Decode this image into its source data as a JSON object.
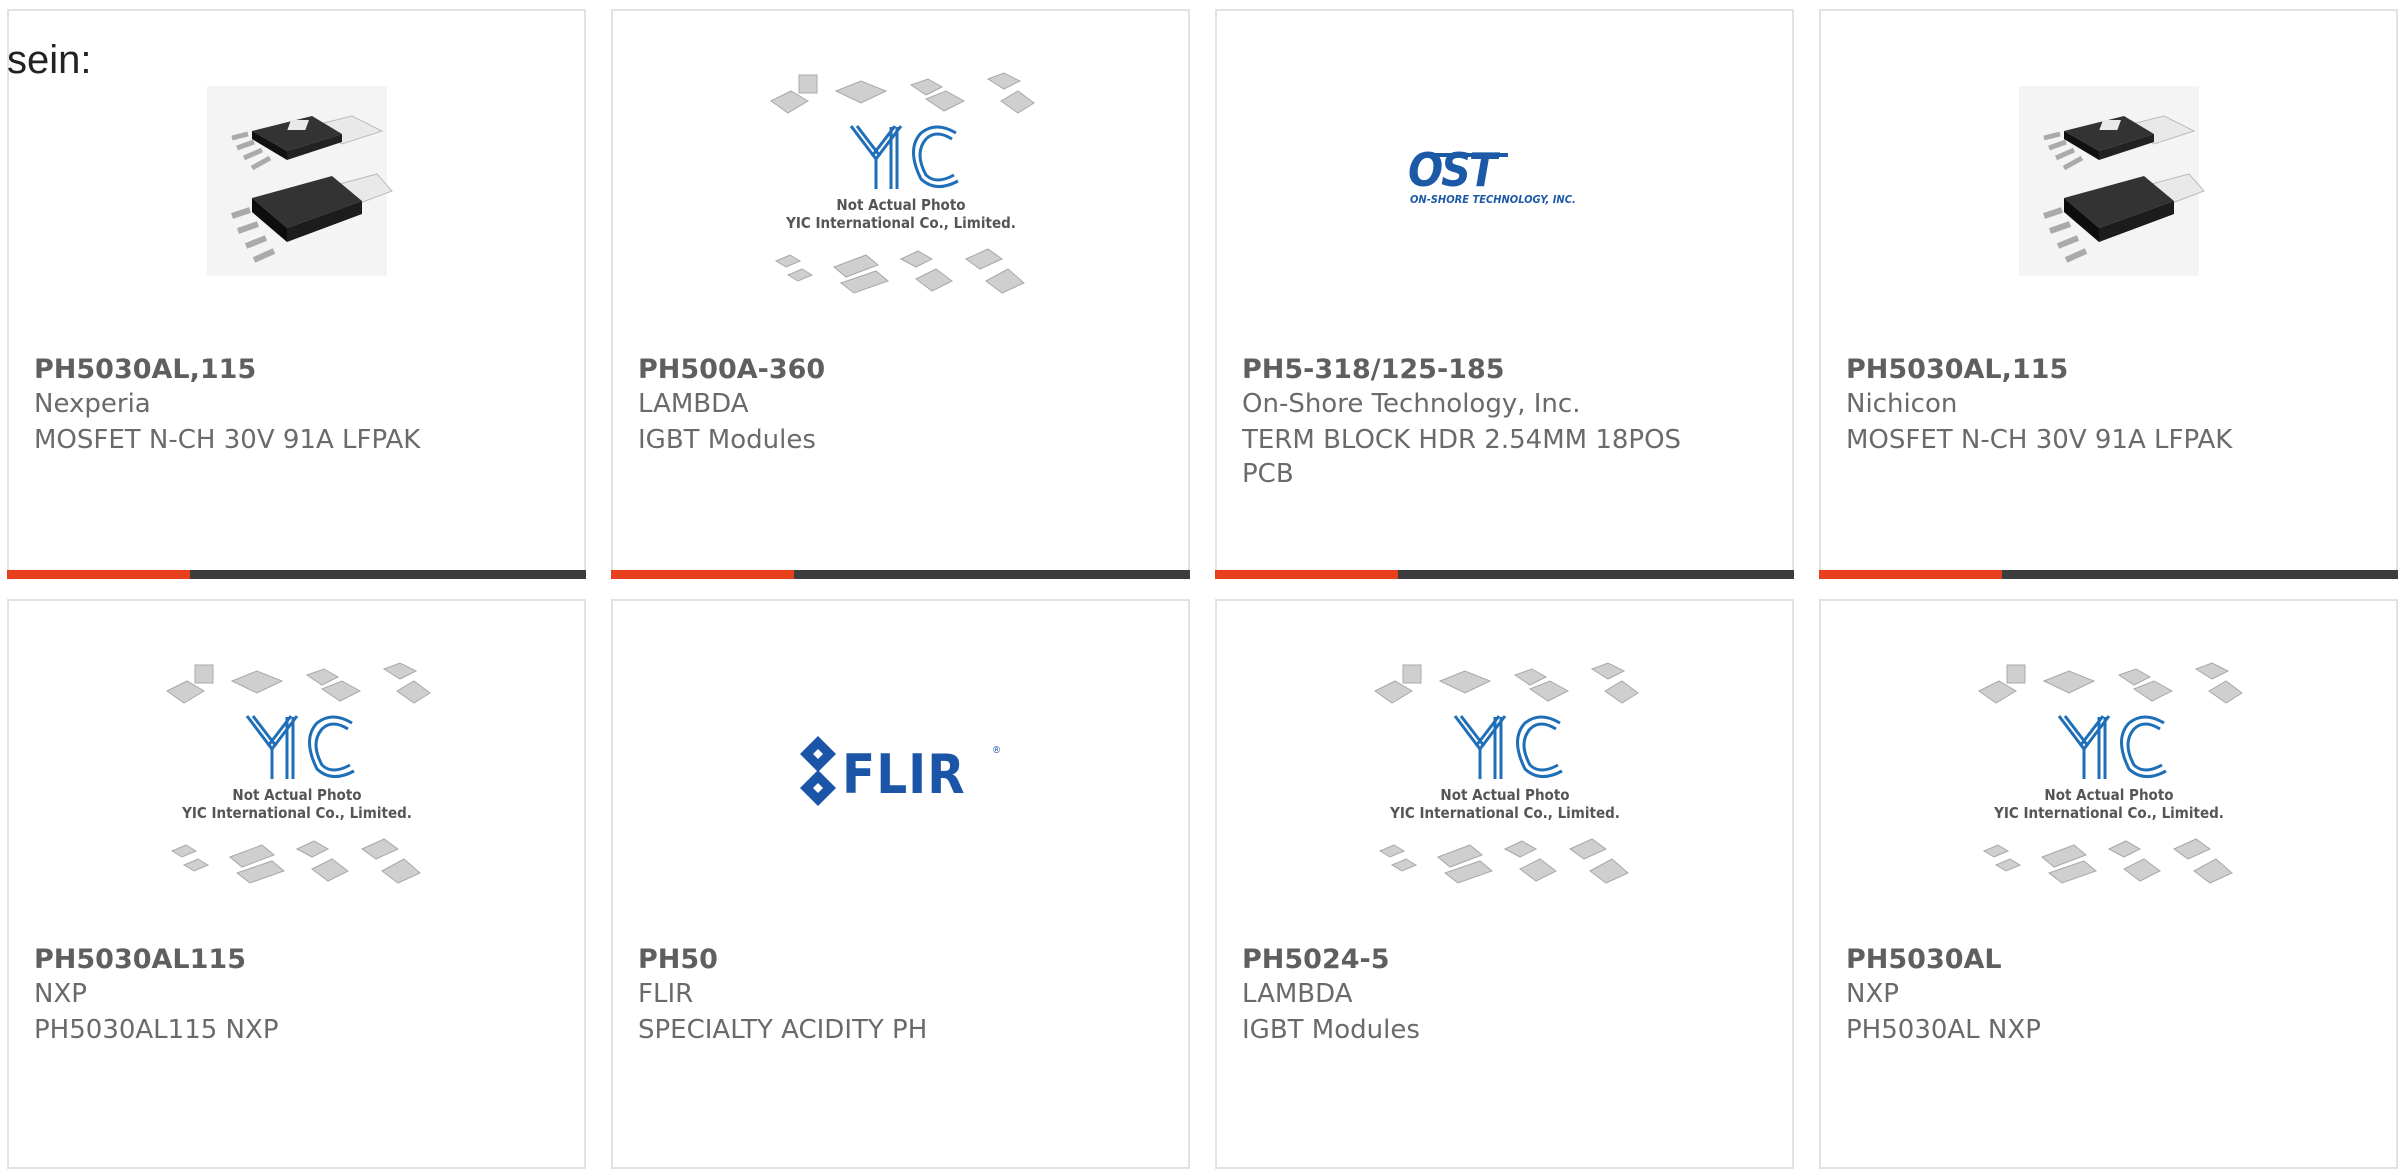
{
  "intro_text": "sein:",
  "colors": {
    "accent": "#e8401c",
    "bar": "#3d3d3d",
    "border": "#e2e2e2",
    "yic_blue": "#1f6fb8",
    "flir_blue": "#1a55a8"
  },
  "placeholder": {
    "line1": "Not Actual Photo",
    "line2": "YIC International Co., Limited."
  },
  "ost_logo": {
    "mark": "OST",
    "tagline": "ON-SHORE TECHNOLOGY, INC."
  },
  "flir_logo": {
    "mark": "FLIR",
    "registered": "®"
  },
  "products": [
    {
      "part": "PH5030AL,115",
      "manufacturer": "Nexperia",
      "description": "MOSFET N-CH 30V 91A LFPAK",
      "image": "lfpak-mosfet-photo"
    },
    {
      "part": "PH500A-360",
      "manufacturer": "LAMBDA",
      "description": "IGBT Modules",
      "image": "yic-placeholder"
    },
    {
      "part": "PH5-318/125-185",
      "manufacturer": "On-Shore Technology, Inc.",
      "description": "TERM BLOCK HDR 2.54MM 18POS PCB",
      "image": "ost-logo"
    },
    {
      "part": "PH5030AL,115",
      "manufacturer": "Nichicon",
      "description": "MOSFET N-CH 30V 91A LFPAK",
      "image": "lfpak-mosfet-photo"
    },
    {
      "part": "PH5030AL115",
      "manufacturer": "NXP",
      "description": "PH5030AL115 NXP",
      "image": "yic-placeholder"
    },
    {
      "part": "PH50",
      "manufacturer": "FLIR",
      "description": "SPECIALTY ACIDITY PH",
      "image": "flir-logo"
    },
    {
      "part": "PH5024-5",
      "manufacturer": "LAMBDA",
      "description": "IGBT Modules",
      "image": "yic-placeholder"
    },
    {
      "part": "PH5030AL",
      "manufacturer": "NXP",
      "description": "PH5030AL NXP",
      "image": "yic-placeholder"
    }
  ]
}
